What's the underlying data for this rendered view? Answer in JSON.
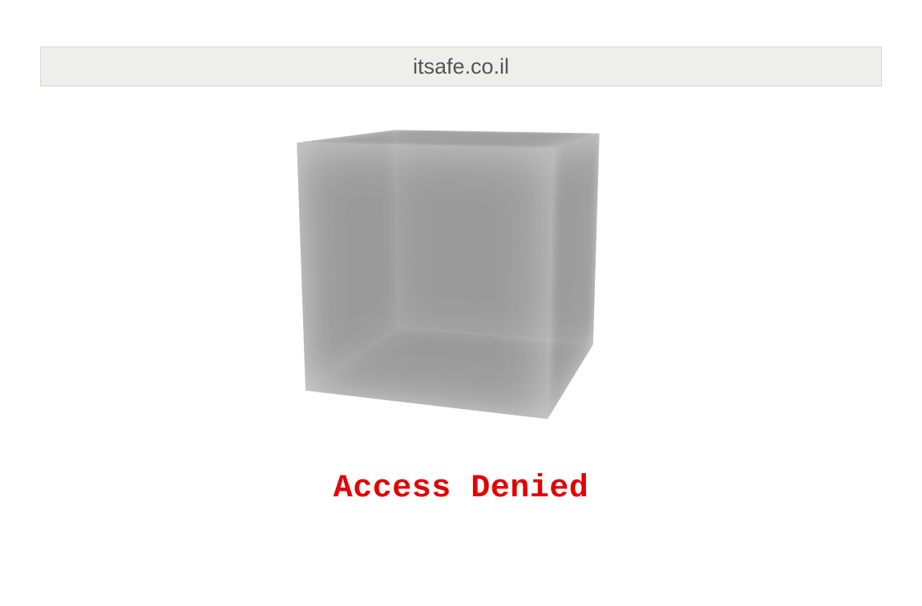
{
  "header": {
    "domain": "itsafe.co.il"
  },
  "message": "Access Denied"
}
